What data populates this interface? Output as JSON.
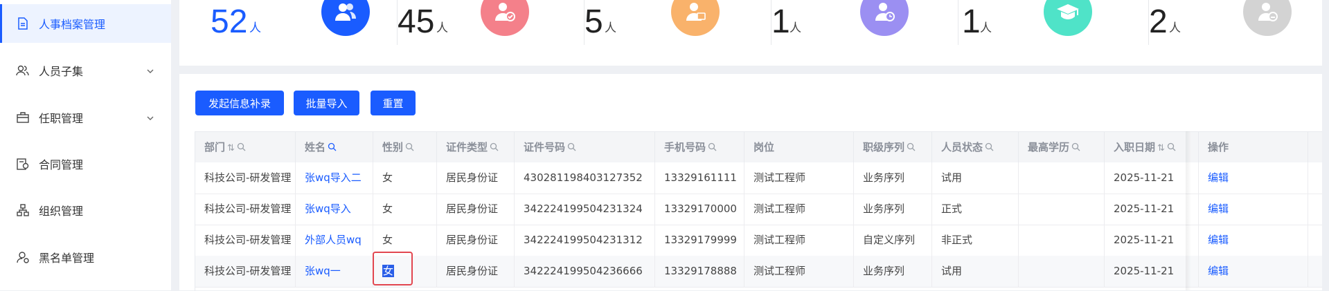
{
  "sidebar": {
    "items": [
      {
        "label": "人事档案管理",
        "icon": "document-icon",
        "active": true
      },
      {
        "label": "人员子集",
        "icon": "users-icon",
        "expandable": true
      },
      {
        "label": "任职管理",
        "icon": "briefcase-icon",
        "expandable": true
      },
      {
        "label": "合同管理",
        "icon": "contract-icon"
      },
      {
        "label": "组织管理",
        "icon": "org-chart-icon"
      },
      {
        "label": "黑名单管理",
        "icon": "user-block-icon"
      }
    ]
  },
  "stats": [
    {
      "value": "52",
      "unit": "人",
      "color": "#1a5cff",
      "icon": "group-icon"
    },
    {
      "value": "45",
      "unit": "人",
      "color": "#f4808a",
      "icon": "user-check-icon"
    },
    {
      "value": "5",
      "unit": "人",
      "color": "#f9b26b",
      "icon": "user-card-icon"
    },
    {
      "value": "1",
      "unit": "人",
      "color": "#9b8ff2",
      "icon": "user-clock-icon"
    },
    {
      "value": "1",
      "unit": "人",
      "color": "#4fe3c8",
      "icon": "graduation-cap-icon"
    },
    {
      "value": "2",
      "unit": "人",
      "color": "#d3d3d3",
      "icon": "user-leave-icon"
    }
  ],
  "toolbar": {
    "initiate_label": "发起信息补录",
    "import_label": "批量导入",
    "reset_label": "重置"
  },
  "table": {
    "columns": [
      "部门",
      "姓名",
      "性别",
      "证件类型",
      "证件号码",
      "手机号码",
      "岗位",
      "职级序列",
      "人员状态",
      "最高学历",
      "入职日期",
      "操作"
    ],
    "rows": [
      [
        "科技公司-研发管理",
        "张wq导入二",
        "女",
        "居民身份证",
        "430281198403127352",
        "13329161111",
        "测试工程师",
        "业务序列",
        "试用",
        "",
        "2025-11-21",
        "编辑"
      ],
      [
        "科技公司-研发管理",
        "张wq导入",
        "女",
        "居民身份证",
        "342224199504231324",
        "13329170000",
        "测试工程师",
        "业务序列",
        "正式",
        "",
        "2025-11-21",
        "编辑"
      ],
      [
        "科技公司-研发管理",
        "外部人员wq",
        "女",
        "居民身份证",
        "342224199504231312",
        "13329179999",
        "测试工程师",
        "自定义序列",
        "非正式",
        "",
        "2025-11-21",
        "编辑"
      ],
      [
        "科技公司-研发管理",
        "张wq一",
        "女",
        "居民身份证",
        "342224199504236666",
        "13329178888",
        "测试工程师",
        "业务序列",
        "试用",
        "",
        "2025-11-21",
        "编辑"
      ]
    ]
  }
}
